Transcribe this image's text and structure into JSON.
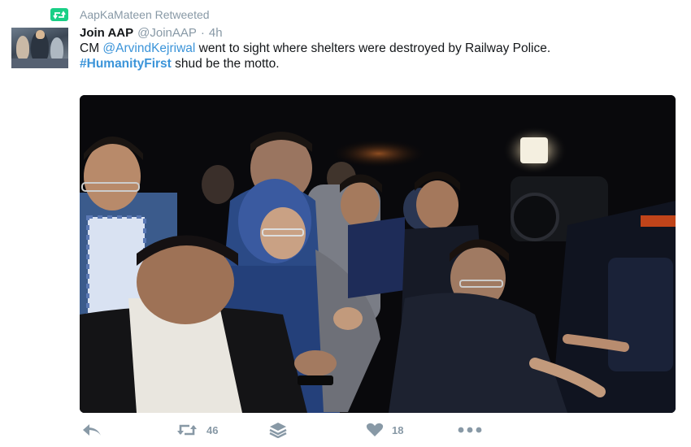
{
  "retweet_context": {
    "text": "AapKaMateen Retweeted",
    "icon": "retweet-icon",
    "color": "#19cf86"
  },
  "tweet": {
    "author": {
      "display_name": "Join AAP",
      "handle": "@JoinAAP",
      "avatar_icon": "profile-avatar"
    },
    "separator": "·",
    "time": "4h",
    "text": {
      "part1": "CM ",
      "mention": "@ArvindKejriwal",
      "part2": " went to sight where shelters were destroyed by Railway Police.",
      "hashtag": "#HumanityFirst",
      "part3": " shud be the motto."
    },
    "media": {
      "kind": "photo",
      "icon": "crowd-photo"
    },
    "actions": {
      "reply": {
        "icon": "reply-icon"
      },
      "retweet": {
        "icon": "retweet-icon",
        "count": "46"
      },
      "add_to_moment": {
        "icon": "stack-icon"
      },
      "like": {
        "icon": "heart-icon",
        "count": "18"
      },
      "more": {
        "icon": "more-dots-icon"
      }
    }
  },
  "colors": {
    "link": "#3b94d9",
    "muted": "#8899a6",
    "text": "#14171a"
  }
}
